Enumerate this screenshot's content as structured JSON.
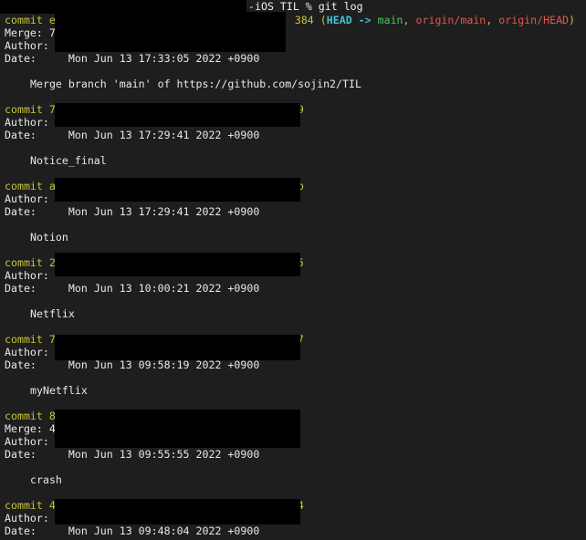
{
  "prompt": {
    "suffix": "-iOS TIL % git log"
  },
  "commits": [
    {
      "hash_start": "e9",
      "hash_end": "384",
      "refs": {
        "open": " (",
        "head": "HEAD -> ",
        "main": "main",
        "sep1": ", ",
        "origin_main": "origin/main",
        "sep2": ", ",
        "origin_head": "origin/HEAD",
        "close": ")"
      },
      "merge_label": "Merge: 7a",
      "author_label": "Author: s",
      "date_label": "Date:",
      "date": "Mon Jun 13 17:33:05 2022 +0900",
      "message": "Merge branch 'main' of https://github.com/sojin2/TIL"
    },
    {
      "hash_start": "7",
      "hash_end": "9",
      "author_label": "Author:",
      "date_label": "Date:",
      "date": "Mon Jun 13 17:29:41 2022 +0900",
      "message": "Notice_final"
    },
    {
      "hash_start": "a",
      "hash_end": "b",
      "author_label": "Author:",
      "date_label": "Date:",
      "date": "Mon Jun 13 17:29:41 2022 +0900",
      "message": "Notion"
    },
    {
      "hash_start": "2",
      "hash_end": "5",
      "author_label": "Author:",
      "date_label": "Date:",
      "date": "Mon Jun 13 10:00:21 2022 +0900",
      "message": "Netflix"
    },
    {
      "hash_start": "7",
      "hash_end": "7",
      "author_label": "Author:",
      "date_label": "Date:",
      "date": "Mon Jun 13 09:58:19 2022 +0900",
      "message": "myNetflix"
    },
    {
      "hash_start": "8",
      "hash_end": "",
      "merge_label": "Merge: 4",
      "author_label": "Author:",
      "date_label": "Date:",
      "date": "Mon Jun 13 09:55:55 2022 +0900",
      "message": "crash"
    },
    {
      "hash_start": "4",
      "hash_end": "4",
      "author_label": "Author:",
      "date_label": "Date:",
      "date": "Mon Jun 13 09:48:04 2022 +0900"
    }
  ],
  "labels": {
    "commit_word": "commit "
  }
}
